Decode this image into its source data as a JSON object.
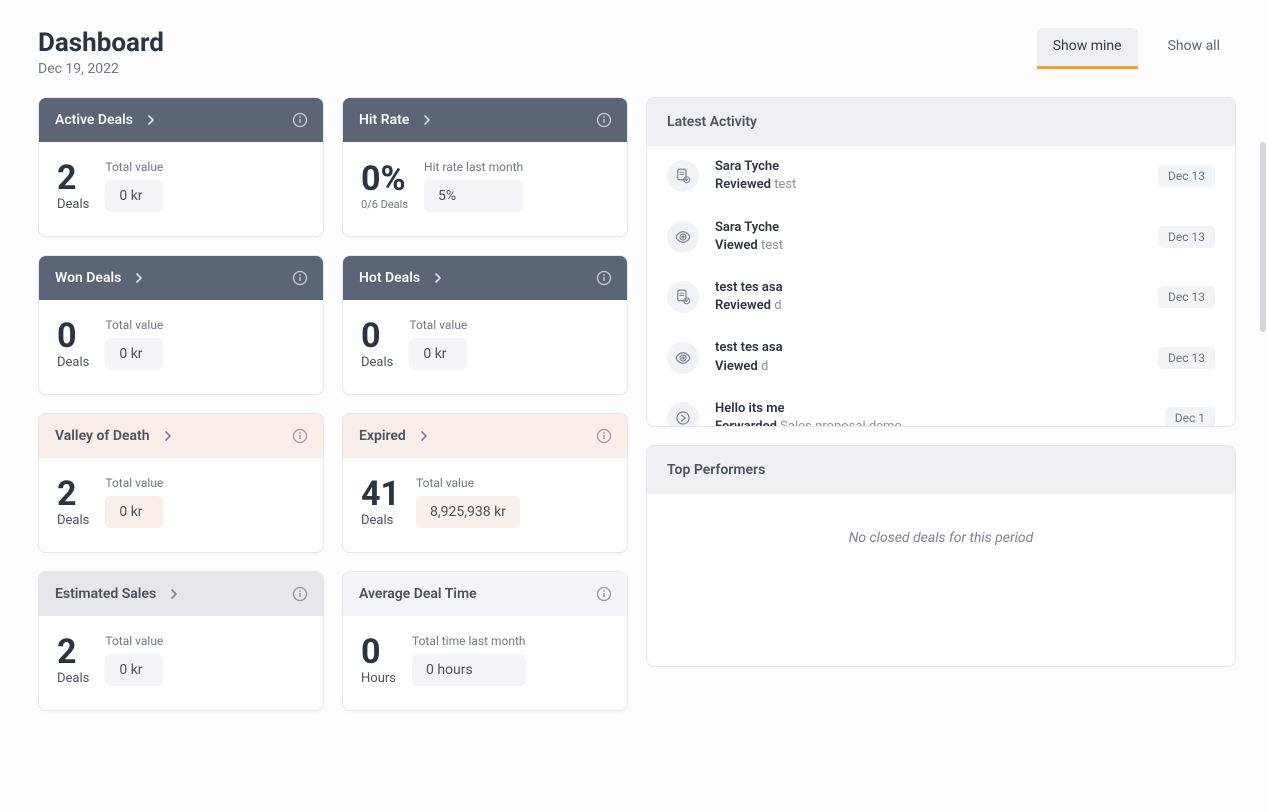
{
  "header": {
    "title": "Dashboard",
    "date": "Dec 19, 2022"
  },
  "tabs": {
    "show_mine": "Show mine",
    "show_all": "Show all"
  },
  "cards": {
    "active_deals": {
      "title": "Active Deals",
      "count": "2",
      "unit": "Deals",
      "sub_label": "Total value",
      "value": "0 kr"
    },
    "hit_rate": {
      "title": "Hit Rate",
      "percent": "0%",
      "deals_sub": "0/6 Deals",
      "sub_label": "Hit rate last month",
      "value": "5%"
    },
    "won_deals": {
      "title": "Won Deals",
      "count": "0",
      "unit": "Deals",
      "sub_label": "Total value",
      "value": "0 kr"
    },
    "hot_deals": {
      "title": "Hot Deals",
      "count": "0",
      "unit": "Deals",
      "sub_label": "Total value",
      "value": "0 kr"
    },
    "valley": {
      "title": "Valley of Death",
      "count": "2",
      "unit": "Deals",
      "sub_label": "Total value",
      "value": "0 kr"
    },
    "expired": {
      "title": "Expired",
      "count": "41",
      "unit": "Deals",
      "sub_label": "Total value",
      "value": "8,925,938 kr"
    },
    "estimated": {
      "title": "Estimated Sales",
      "count": "2",
      "unit": "Deals",
      "sub_label": "Total value",
      "value": "0 kr"
    },
    "avg_deal": {
      "title": "Average Deal Time",
      "count": "0",
      "unit": "Hours",
      "sub_label": "Total time last month",
      "value": "0 hours"
    }
  },
  "latest_activity": {
    "title": "Latest Activity",
    "items": [
      {
        "name": "Sara Tyche",
        "action": "Reviewed",
        "object": "test",
        "date": "Dec 13",
        "icon": "review"
      },
      {
        "name": "Sara Tyche",
        "action": "Viewed",
        "object": "test",
        "date": "Dec 13",
        "icon": "view"
      },
      {
        "name": "test tes asa",
        "action": "Reviewed",
        "object": "d",
        "date": "Dec 13",
        "icon": "review"
      },
      {
        "name": "test tes asa",
        "action": "Viewed",
        "object": "d",
        "date": "Dec 13",
        "icon": "view"
      },
      {
        "name": "Hello its me",
        "action": "Forwarded",
        "object": "Sales proposal demo",
        "date": "Dec 1",
        "icon": "forward"
      }
    ],
    "cut_name": "test tes asa"
  },
  "top_performers": {
    "title": "Top Performers",
    "empty": "No closed deals for this period"
  }
}
